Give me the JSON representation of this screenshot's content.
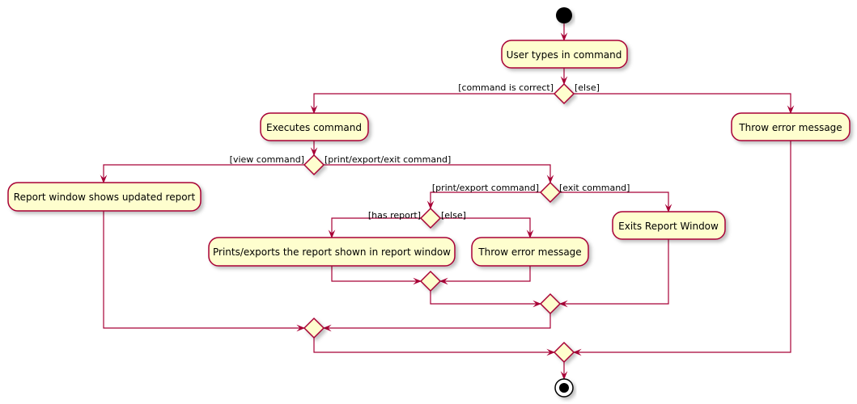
{
  "colors": {
    "line": "#A80036",
    "fill": "#FEFECE",
    "start": "#000000"
  },
  "actions": {
    "user_types": "User types in command",
    "executes": "Executes command",
    "throw_error_1": "Throw error message",
    "report_window": "Report window shows updated report",
    "prints_exports": "Prints/exports the report shown in report window",
    "throw_error_2": "Throw error message",
    "exits": "Exits Report Window"
  },
  "guards": {
    "command_correct": "[command is correct]",
    "else_1": "[else]",
    "view_command": "[view command]",
    "print_export_exit": "[print/export/exit command]",
    "print_export": "[print/export command]",
    "exit_command": "[exit command]",
    "has_report": "[has report]",
    "else_2": "[else]"
  }
}
